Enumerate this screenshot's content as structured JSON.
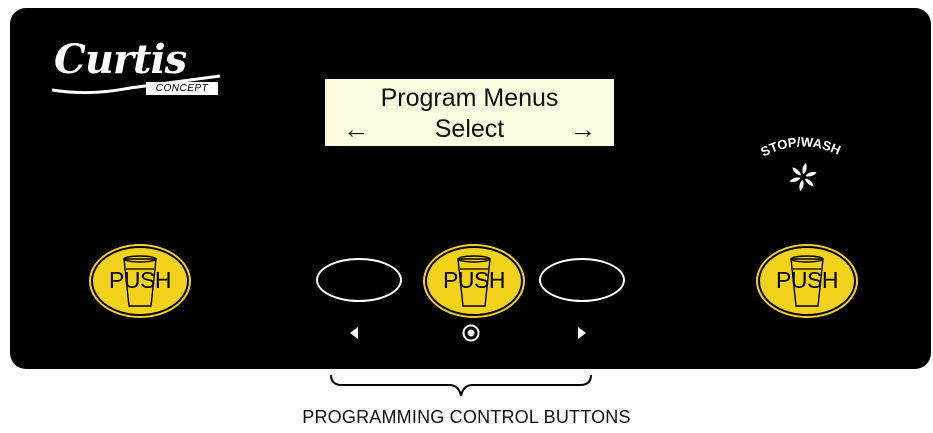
{
  "brand": {
    "logo_text": "Curtis",
    "logo_subtext": "CONCEPT"
  },
  "display": {
    "line1": "Program Menus",
    "line2": "Select",
    "left_arrow": "←",
    "right_arrow": "→"
  },
  "stop_wash": {
    "label": "STOP/WASH",
    "icon": "pinwheel-icon"
  },
  "buttons": {
    "push_left": "PUSH",
    "push_center": "PUSH",
    "push_right": "PUSH"
  },
  "indicators": {
    "left": "left-triangle-icon",
    "center": "target-circle-icon",
    "right": "right-triangle-icon"
  },
  "caption": "PROGRAMMING CONTROL BUTTONS",
  "colors": {
    "panel": "#000000",
    "push_button": "#f2d21b",
    "lcd_background": "#fffbe0"
  }
}
